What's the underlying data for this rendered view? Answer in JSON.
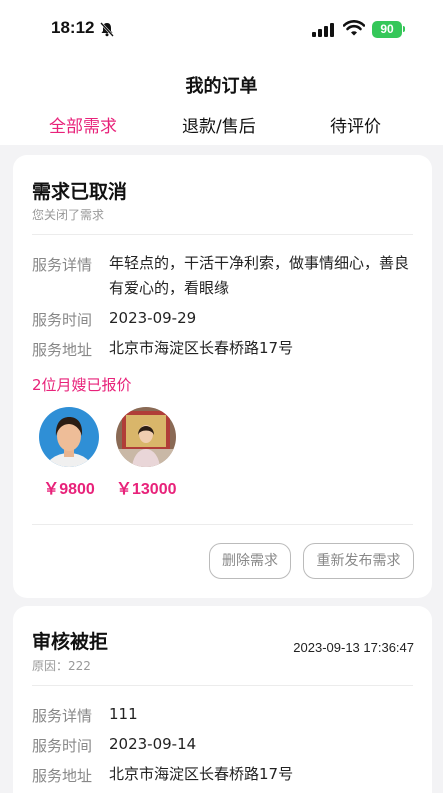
{
  "status_bar": {
    "time": "18:12",
    "battery": "90",
    "icons": [
      "bell-muted-icon",
      "signal-icon",
      "wifi-icon",
      "battery-icon"
    ]
  },
  "header": {
    "title": "我的订单",
    "tabs": [
      {
        "label": "全部需求",
        "active": true
      },
      {
        "label": "退款/售后",
        "active": false
      },
      {
        "label": "待评价",
        "active": false
      }
    ]
  },
  "colors": {
    "accent": "#e8227a",
    "background": "#f3f3f5"
  },
  "orders": [
    {
      "status": "需求已取消",
      "note": "您关闭了需求",
      "details": [
        {
          "label": "服务详情",
          "value": "年轻点的，干活干净利索，做事情细心，善良有爱心的，看眼缘"
        },
        {
          "label": "服务时间",
          "value": "2023-09-29"
        },
        {
          "label": "服务地址",
          "value": "北京市海淀区长春桥路17号"
        }
      ],
      "quote_heading": "2位月嫂已报价",
      "quotes": [
        {
          "price": "￥9800"
        },
        {
          "price": "￥13000"
        }
      ],
      "actions": {
        "delete": "删除需求",
        "republish": "重新发布需求"
      }
    },
    {
      "status": "审核被拒",
      "note": "原因：222",
      "time": "2023-09-13 17:36:47",
      "details": [
        {
          "label": "服务详情",
          "value": "111"
        },
        {
          "label": "服务时间",
          "value": "2023-09-14"
        },
        {
          "label": "服务地址",
          "value": "北京市海淀区长春桥路17号"
        }
      ]
    }
  ]
}
